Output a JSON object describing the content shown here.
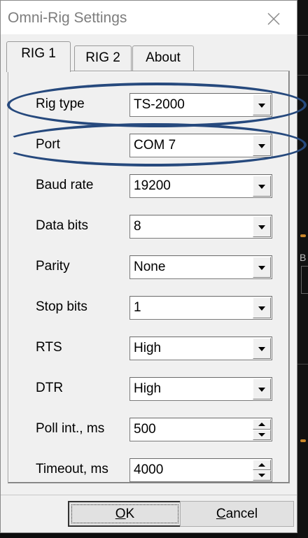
{
  "window": {
    "title": "Omni-Rig Settings"
  },
  "tabs": [
    {
      "label": "RIG 1",
      "active": true
    },
    {
      "label": "RIG 2",
      "active": false
    },
    {
      "label": "About",
      "active": false
    }
  ],
  "settings": [
    {
      "label": "Rig type",
      "value": "TS-2000",
      "control": "dropdown"
    },
    {
      "label": "Port",
      "value": "COM 7",
      "control": "dropdown"
    },
    {
      "label": "Baud rate",
      "value": "19200",
      "control": "dropdown"
    },
    {
      "label": "Data bits",
      "value": "8",
      "control": "dropdown"
    },
    {
      "label": "Parity",
      "value": "None",
      "control": "dropdown"
    },
    {
      "label": "Stop bits",
      "value": "1",
      "control": "dropdown"
    },
    {
      "label": "RTS",
      "value": "High",
      "control": "dropdown"
    },
    {
      "label": "DTR",
      "value": "High",
      "control": "dropdown"
    },
    {
      "label": "Poll int., ms",
      "value": "500",
      "control": "spinner"
    },
    {
      "label": "Timeout, ms",
      "value": "4000",
      "control": "spinner"
    }
  ],
  "buttons": {
    "ok": {
      "mnemonic": "O",
      "rest": "K"
    },
    "cancel": {
      "mnemonic": "C",
      "rest": "ancel"
    }
  },
  "background_fragment": {
    "text": "B"
  },
  "annotation_color": "#26497d",
  "icons": {
    "close": "close-icon",
    "dropdown": "chevron-down-icon",
    "spin_up": "spin-up-icon",
    "spin_down": "spin-down-icon"
  }
}
